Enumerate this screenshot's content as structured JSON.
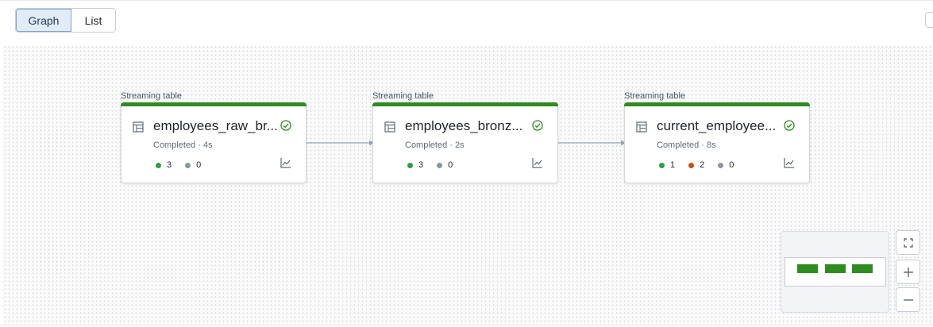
{
  "view_toggle": {
    "graph_label": "Graph",
    "list_label": "List",
    "selected": "Graph"
  },
  "nodes": [
    {
      "type_label": "Streaming table",
      "name": "employees_raw_br...",
      "status": "Completed · 4s",
      "counts": [
        {
          "color": "#2ea043",
          "value": "3"
        },
        {
          "color": "#8b96a3",
          "value": "0"
        }
      ]
    },
    {
      "type_label": "Streaming table",
      "name": "employees_bronz...",
      "status": "Completed · 2s",
      "counts": [
        {
          "color": "#2ea043",
          "value": "3"
        },
        {
          "color": "#8b96a3",
          "value": "0"
        }
      ]
    },
    {
      "type_label": "Streaming table",
      "name": "current_employee...",
      "status": "Completed · 8s",
      "counts": [
        {
          "color": "#2ea043",
          "value": "1"
        },
        {
          "color": "#c4501c",
          "value": "2"
        },
        {
          "color": "#8b96a3",
          "value": "0"
        }
      ]
    }
  ],
  "colors": {
    "success": "#2e8b1f",
    "selected_bg": "#e2ecf7",
    "edge": "#9aa5b1"
  },
  "icons": [
    "table-icon",
    "check-circle-icon",
    "metrics-chart-icon",
    "fit-view-icon",
    "zoom-in-icon",
    "zoom-out-icon"
  ]
}
